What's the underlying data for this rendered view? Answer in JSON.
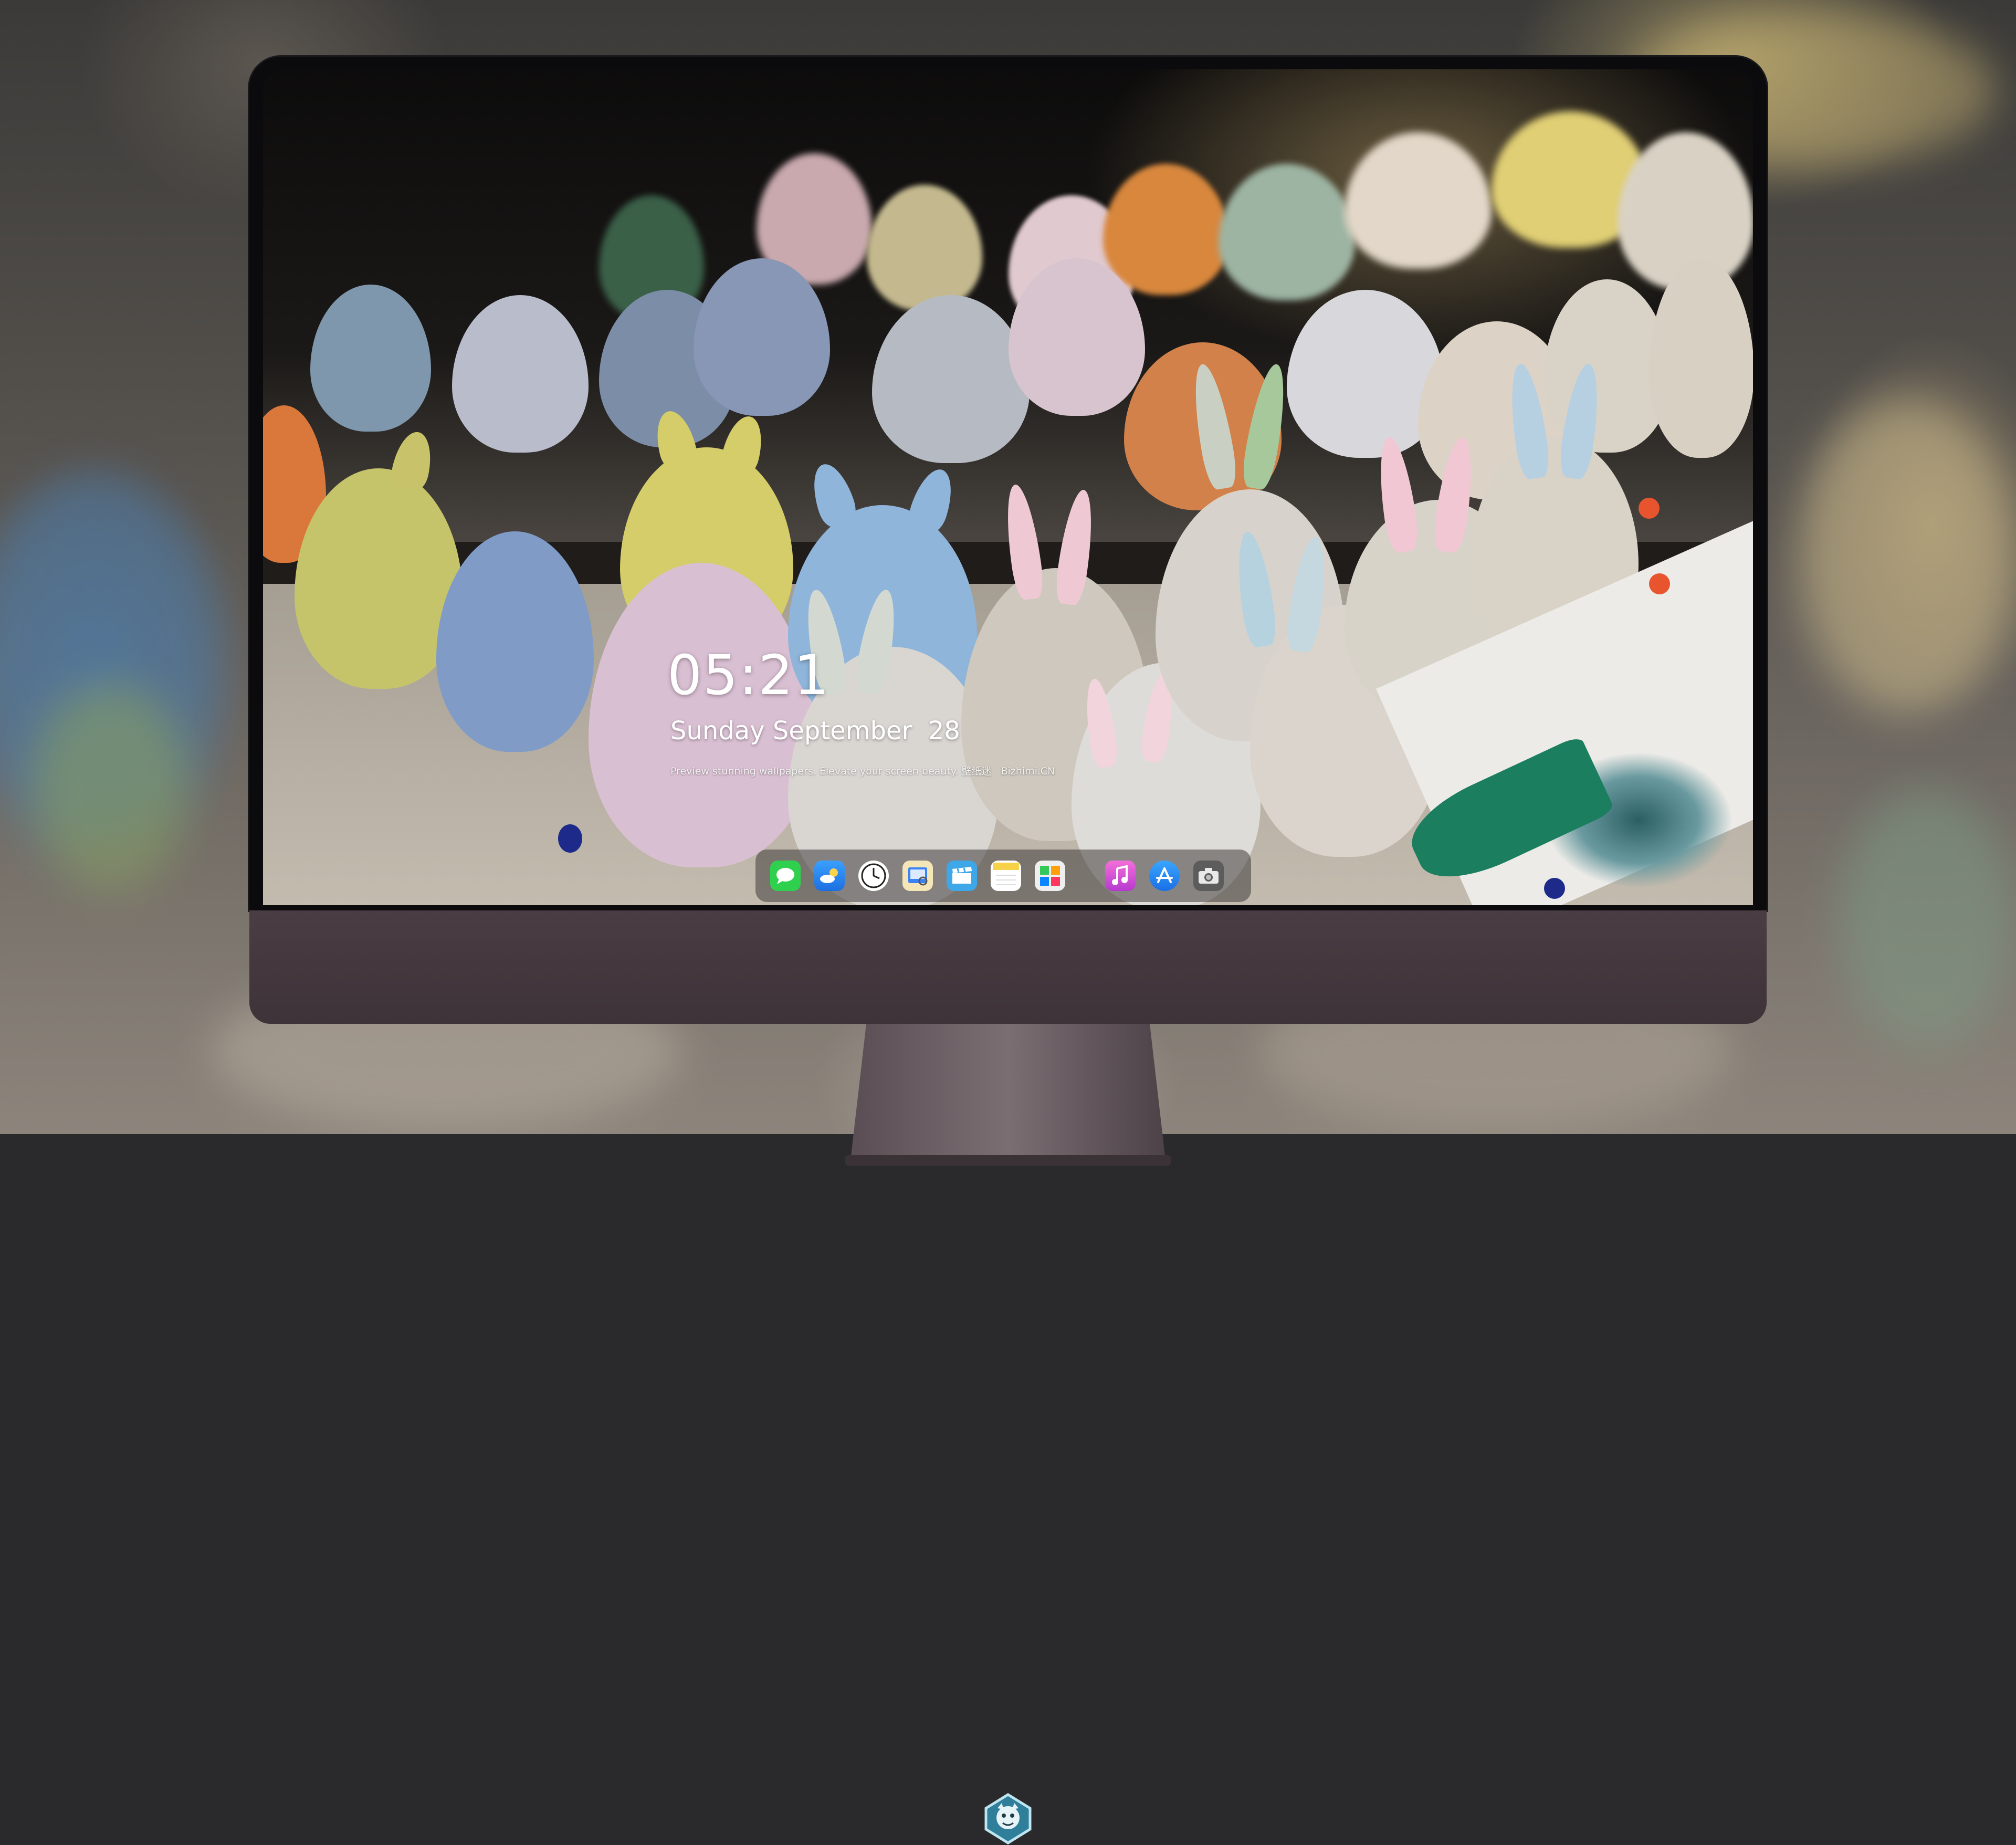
{
  "lockscreen": {
    "time": "05:21",
    "date": "Sunday September  28",
    "tagline": "Preview stunning wallpapers. Elevate your screen beauty. 壁纸迷   Bizhimi.CN"
  },
  "dock": {
    "apps": [
      {
        "name": "Messages",
        "icon": "messages-icon",
        "color": "#2fd04d"
      },
      {
        "name": "Weather",
        "icon": "weather-icon",
        "color": "#2d8cf0"
      },
      {
        "name": "Clock",
        "icon": "clock-icon",
        "color": "#ffffff"
      },
      {
        "name": "Preview",
        "icon": "preview-icon",
        "color": "#f2c744"
      },
      {
        "name": "Claquette",
        "icon": "clapper-icon",
        "color": "#3ea7e8"
      },
      {
        "name": "Notes",
        "icon": "notes-icon",
        "color": "#f7d147"
      },
      {
        "name": "Photo Booth",
        "icon": "photos-icon",
        "color": "#e8e8e8"
      },
      {
        "name": "iTunes",
        "icon": "music-icon",
        "color": "#e35ad6"
      },
      {
        "name": "App Store",
        "icon": "app-store-icon",
        "color": "#1f8cf2"
      },
      {
        "name": "Screenshot",
        "icon": "camera-icon",
        "color": "#6d6d6d"
      }
    ]
  },
  "colors": {
    "accent": "#ffffff",
    "chin": "#463a40",
    "bezel": "#0b0b0d"
  }
}
